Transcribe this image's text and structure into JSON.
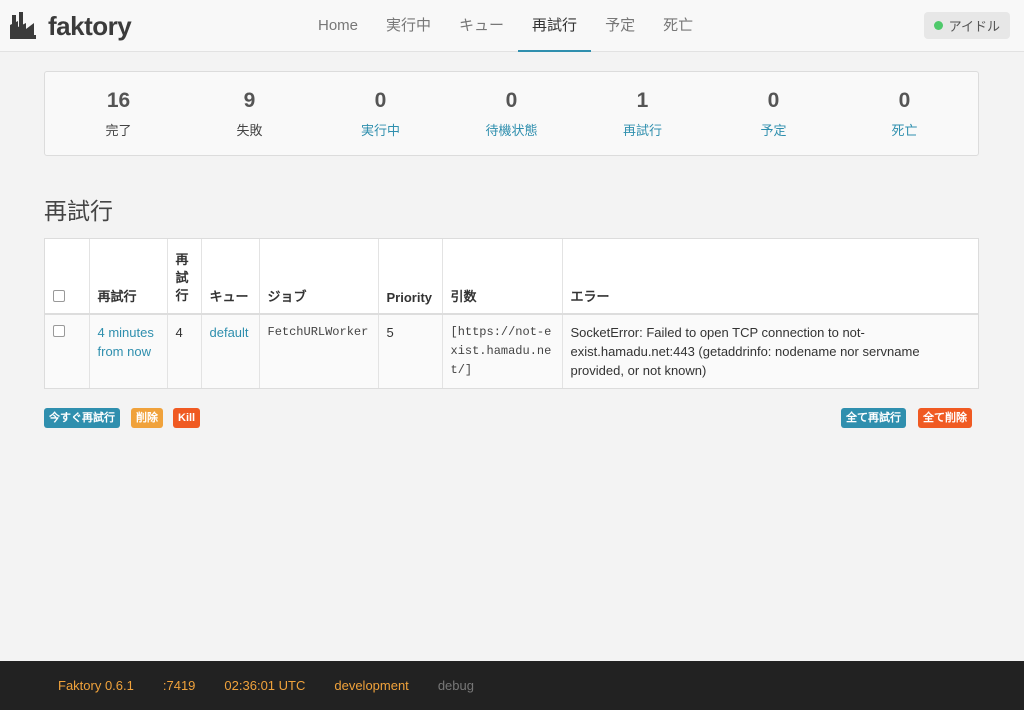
{
  "brand": "faktory",
  "nav": [
    {
      "label": "Home",
      "active": false
    },
    {
      "label": "実行中",
      "active": false
    },
    {
      "label": "キュー",
      "active": false
    },
    {
      "label": "再試行",
      "active": true
    },
    {
      "label": "予定",
      "active": false
    },
    {
      "label": "死亡",
      "active": false
    }
  ],
  "status": {
    "label": "アイドル",
    "color": "#4fc96b"
  },
  "summary": [
    {
      "value": "16",
      "label": "完了"
    },
    {
      "value": "9",
      "label": "失敗"
    },
    {
      "value": "0",
      "label": "実行中"
    },
    {
      "value": "0",
      "label": "待機状態"
    },
    {
      "value": "1",
      "label": "再試行"
    },
    {
      "value": "0",
      "label": "予定"
    },
    {
      "value": "0",
      "label": "死亡"
    }
  ],
  "page_title": "再試行",
  "table": {
    "headers": [
      "再試行",
      "再試行",
      "キュー",
      "ジョブ",
      "Priority",
      "引数",
      "エラー"
    ],
    "header_retry_count": "再\n試\n行",
    "rows": [
      {
        "retry_at": "4 minutes from now",
        "retry_count": "4",
        "queue": "default",
        "job": "FetchURLWorker",
        "priority": "5",
        "args": "[https://not-exist.hamadu.net/]",
        "error": "SocketError: Failed to open TCP connection to not-exist.hamadu.net:443 (getaddrinfo: nodename nor servname provided, or not known)"
      }
    ]
  },
  "buttons": {
    "retry_now": "今すぐ再試行",
    "delete": "削除",
    "kill": "Kill",
    "retry_all": "全て再試行",
    "delete_all": "全て削除"
  },
  "footer": {
    "version": "Faktory 0.6.1",
    "port": ":7419",
    "time": "02:36:01 UTC",
    "env": "development",
    "debug": "debug"
  },
  "colors": {
    "accent": "#2f8fae",
    "warn": "#f0a23b",
    "danger": "#f05a22",
    "footer_bg": "#222222"
  }
}
